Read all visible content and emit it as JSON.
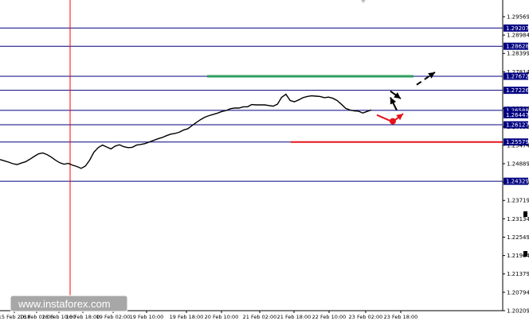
{
  "watermark": "www.instaforex.com",
  "colors": {
    "price": "#000000",
    "level_line": "#00007f",
    "level_box": "#000080",
    "vline": "#ff0000",
    "resistance": "#2e9e5e",
    "support": "#e8121b",
    "forecast_black": "#000000",
    "forecast_red": "#e8121b"
  },
  "chart_data": {
    "type": "line",
    "instrument_type": "price chart",
    "ylim": [
      1.20209,
      1.301
    ],
    "y_ticks": [
      "1.29569",
      "1.28984",
      "1.28399",
      "1.27814",
      "1.26644",
      "1.26059",
      "1.25474",
      "1.24889",
      "1.24304",
      "1.23719",
      "1.23134",
      "1.22549",
      "1.21964",
      "1.21379",
      "1.20794",
      "1.20209"
    ],
    "x_ticks": [
      "15 Feb 2018",
      "16 Feb 02:00",
      "16 Feb 10:00",
      "16 Feb 18:00",
      "19 Feb 02:00",
      "19 Feb 10:00",
      "19 Feb 18:00",
      "20 Feb 10:00",
      "21 Feb 02:00",
      "21 Feb 18:00",
      "22 Feb 10:00",
      "23 Feb 02:00",
      "23 Feb 18:00"
    ],
    "levels": [
      "1.29207",
      "1.28628",
      "1.27672",
      "1.27226",
      "1.26588",
      "1.26447",
      "1.26127",
      "1.25579",
      "1.24329"
    ],
    "resistance_level": 1.27672,
    "support_level": 1.25579,
    "vertical_marker_x": "16 Feb 10:00",
    "series": [
      {
        "values": [
          1.2502,
          1.2498,
          1.2494,
          1.2489,
          1.2486,
          1.2491,
          1.2495,
          1.2503,
          1.2512,
          1.252,
          1.2523,
          1.2518,
          1.251,
          1.25,
          1.2492,
          1.2487,
          1.249,
          1.2484,
          1.248,
          1.2474,
          1.2481,
          1.25,
          1.2525,
          1.254,
          1.2548,
          1.2542,
          1.2536,
          1.2545,
          1.2549,
          1.2543,
          1.254,
          1.2541,
          1.2548,
          1.255,
          1.2553,
          1.2558,
          1.2563,
          1.2568,
          1.2572,
          1.2578,
          1.2583,
          1.2585,
          1.2589,
          1.2596,
          1.26,
          1.261,
          1.262,
          1.2629,
          1.2637,
          1.2642,
          1.2646,
          1.265,
          1.2655,
          1.2658,
          1.2664,
          1.2666,
          1.2666,
          1.267,
          1.267,
          1.2677,
          1.2676,
          1.2676,
          1.2676,
          1.2674,
          1.2672,
          1.2678,
          1.27,
          1.271,
          1.269,
          1.2686,
          1.2692,
          1.2699,
          1.2703,
          1.2705,
          1.2704,
          1.2703,
          1.2699,
          1.2701,
          1.2697,
          1.269,
          1.2678,
          1.2665,
          1.266,
          1.2657,
          1.2656,
          1.265,
          1.2655,
          1.266
        ]
      }
    ],
    "forecast_black": [
      [
        1.2659,
        1.27
      ],
      [
        1.272,
        1.2696
      ],
      [
        1.2696,
        1.272
      ],
      [
        1.274,
        1.278
      ]
    ],
    "forecast_red": [
      [
        1.2644,
        1.2624
      ],
      [
        1.2624,
        1.2648
      ]
    ]
  }
}
